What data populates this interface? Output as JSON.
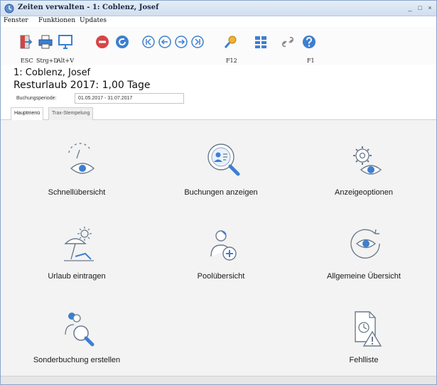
{
  "window": {
    "title": "Zeiten verwalten - 1: Coblenz, Josef",
    "controls": {
      "minimize": "_",
      "maximize": "□",
      "close": "×"
    }
  },
  "menu": [
    "Fenster",
    "Funktionen",
    "Updates"
  ],
  "toolbar": {
    "buttons": [
      {
        "icon": "exit-door-icon",
        "label": "ESC"
      },
      {
        "icon": "printer-icon",
        "label": "Strg+D"
      },
      {
        "icon": "monitor-icon",
        "label": "Alt+V"
      },
      {
        "icon": "stop-icon",
        "label": ""
      },
      {
        "icon": "refresh-icon",
        "label": ""
      },
      {
        "icon": "first-icon",
        "label": ""
      },
      {
        "icon": "previous-icon",
        "label": ""
      },
      {
        "icon": "next-icon",
        "label": ""
      },
      {
        "icon": "last-icon",
        "label": ""
      },
      {
        "icon": "search-key-icon",
        "label": "F12"
      },
      {
        "icon": "grid-icon",
        "label": ""
      },
      {
        "icon": "link-icon",
        "label": ""
      },
      {
        "icon": "help-icon",
        "label": "F1"
      }
    ]
  },
  "info": {
    "employee": "1: Coblenz, Josef",
    "vacation": "Resturlaub 2017: 1,00 Tage",
    "period_label": "Buchungsperiode:",
    "period_value": "01.05.2017 - 31.07.2017"
  },
  "tabs": [
    {
      "label": "Hauptmenü",
      "active": true
    },
    {
      "label": "Trax-Stempelung",
      "active": false
    }
  ],
  "tiles": [
    {
      "icon": "clock-eye-icon",
      "label": "Schnellübersicht"
    },
    {
      "icon": "booking-search-icon",
      "label": "Buchungen anzeigen"
    },
    {
      "icon": "settings-eye-icon",
      "label": "Anzeigeoptionen"
    },
    {
      "icon": "beach-vacation-icon",
      "label": "Urlaub eintragen"
    },
    {
      "icon": "person-add-icon",
      "label": "Poolübersicht"
    },
    {
      "icon": "eye-refresh-icon",
      "label": "Allgemeine Übersicht"
    },
    {
      "icon": "people-search-icon",
      "label": "Sonderbuchung erstellen"
    },
    {
      "icon": "document-warning-icon",
      "label": "Fehlliste"
    }
  ],
  "colors": {
    "accent": "#3d7fd1",
    "stop": "#d64545",
    "icon_stroke": "#6b7a8c"
  }
}
